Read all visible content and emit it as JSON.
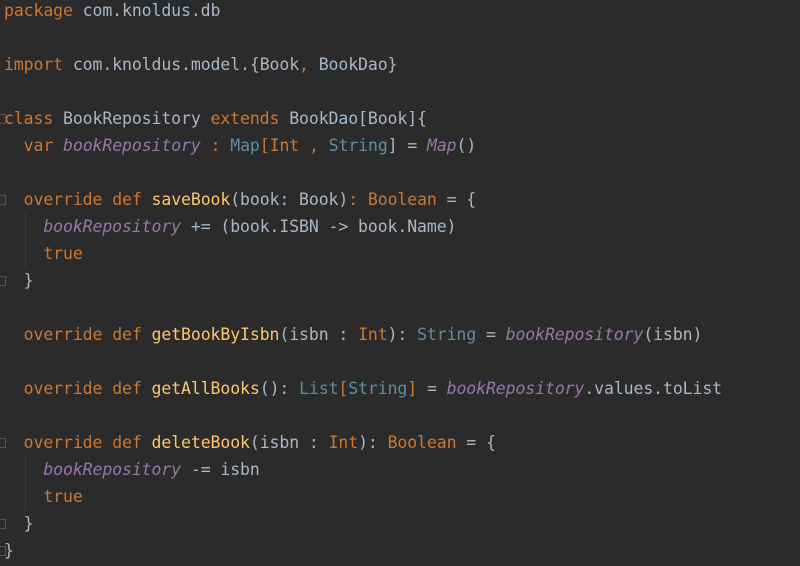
{
  "editor": {
    "lines": [
      {
        "t": "package com.knoldus.db"
      },
      {
        "t": ""
      },
      {
        "t": "import com.knoldus.model.{Book, BookDao}"
      },
      {
        "t": ""
      },
      {
        "t": "class BookRepository extends BookDao[Book]{"
      },
      {
        "t": "  var bookRepository : Map[Int , String] = Map()"
      },
      {
        "t": ""
      },
      {
        "t": "  override def saveBook(book: Book): Boolean = {"
      },
      {
        "t": "    bookRepository += (book.ISBN -> book.Name)"
      },
      {
        "t": "    true"
      },
      {
        "t": "  }"
      },
      {
        "t": ""
      },
      {
        "t": "  override def getBookByIsbn(isbn : Int): String = bookRepository(isbn)"
      },
      {
        "t": ""
      },
      {
        "t": "  override def getAllBooks(): List[String] = bookRepository.values.toList"
      },
      {
        "t": ""
      },
      {
        "t": "  override def deleteBook(isbn : Int): Boolean = {"
      },
      {
        "t": "    bookRepository -= isbn"
      },
      {
        "t": "    true"
      },
      {
        "t": "  }"
      },
      {
        "t": "}"
      }
    ],
    "tokens": {
      "l0": [
        [
          "kw",
          "package"
        ],
        [
          "id",
          " com.knoldus.db"
        ]
      ],
      "l2": [
        [
          "kw",
          "import"
        ],
        [
          "id",
          " com.knoldus.model.{Book"
        ],
        [
          "kw",
          ","
        ],
        [
          "id",
          " BookDao}"
        ]
      ],
      "l4": [
        [
          "kw",
          "class"
        ],
        [
          "id",
          " BookRepository "
        ],
        [
          "kw",
          "extends"
        ],
        [
          "id",
          " BookDao[Book]{"
        ]
      ],
      "l5": [
        [
          "id",
          "  "
        ],
        [
          "kw",
          "var"
        ],
        [
          "id",
          " "
        ],
        [
          "it",
          "bookRepository"
        ],
        [
          "id",
          " "
        ],
        [
          "kw",
          ":"
        ],
        [
          "id",
          " "
        ],
        [
          "tyl",
          "Map"
        ],
        [
          "kw",
          "["
        ],
        [
          "kw",
          "Int"
        ],
        [
          "id",
          " "
        ],
        [
          "kw",
          ","
        ],
        [
          "id",
          " "
        ],
        [
          "tyl",
          "String"
        ],
        [
          "id",
          "] = "
        ],
        [
          "it",
          "Map"
        ],
        [
          "id",
          "()"
        ]
      ],
      "l7": [
        [
          "id",
          "  "
        ],
        [
          "kw",
          "override"
        ],
        [
          "id",
          " "
        ],
        [
          "kw",
          "def"
        ],
        [
          "id",
          " "
        ],
        [
          "fn",
          "saveBook"
        ],
        [
          "id",
          "(book: Book)"
        ],
        [
          "kw",
          ":"
        ],
        [
          "id",
          " "
        ],
        [
          "kw",
          "Boolean"
        ],
        [
          "id",
          " = {"
        ]
      ],
      "l8": [
        [
          "id",
          "    "
        ],
        [
          "it",
          "bookRepository"
        ],
        [
          "id",
          " += (book.ISBN -> book.Name)"
        ]
      ],
      "l9": [
        [
          "id",
          "    "
        ],
        [
          "kw",
          "true"
        ]
      ],
      "l10": [
        [
          "id",
          "  }"
        ]
      ],
      "l12": [
        [
          "id",
          "  "
        ],
        [
          "kw",
          "override"
        ],
        [
          "id",
          " "
        ],
        [
          "kw",
          "def"
        ],
        [
          "id",
          " "
        ],
        [
          "fn",
          "getBookByIsbn"
        ],
        [
          "id",
          "(isbn : "
        ],
        [
          "kw",
          "Int"
        ],
        [
          "id",
          "): "
        ],
        [
          "tyl",
          "String"
        ],
        [
          "id",
          " = "
        ],
        [
          "it",
          "bookRepository"
        ],
        [
          "id",
          "(isbn)"
        ]
      ],
      "l14": [
        [
          "id",
          "  "
        ],
        [
          "kw",
          "override"
        ],
        [
          "id",
          " "
        ],
        [
          "kw",
          "def"
        ],
        [
          "id",
          " "
        ],
        [
          "fn",
          "getAllBooks"
        ],
        [
          "id",
          "(): "
        ],
        [
          "tyl",
          "List"
        ],
        [
          "kw",
          "["
        ],
        [
          "tyl",
          "String"
        ],
        [
          "kw",
          "]"
        ],
        [
          "id",
          " = "
        ],
        [
          "it",
          "bookRepository"
        ],
        [
          "id",
          ".values.toList"
        ]
      ],
      "l16": [
        [
          "id",
          "  "
        ],
        [
          "kw",
          "override"
        ],
        [
          "id",
          " "
        ],
        [
          "kw",
          "def"
        ],
        [
          "id",
          " "
        ],
        [
          "fn",
          "deleteBook"
        ],
        [
          "id",
          "(isbn : "
        ],
        [
          "kw",
          "Int"
        ],
        [
          "id",
          "): "
        ],
        [
          "kw",
          "Boolean"
        ],
        [
          "id",
          " = {"
        ]
      ],
      "l17": [
        [
          "id",
          "    "
        ],
        [
          "it",
          "bookRepository"
        ],
        [
          "id",
          " -= isbn"
        ]
      ],
      "l18": [
        [
          "id",
          "    "
        ],
        [
          "kw",
          "true"
        ]
      ],
      "l19": [
        [
          "id",
          "  }"
        ]
      ],
      "l20": [
        [
          "id",
          "}"
        ]
      ]
    }
  }
}
